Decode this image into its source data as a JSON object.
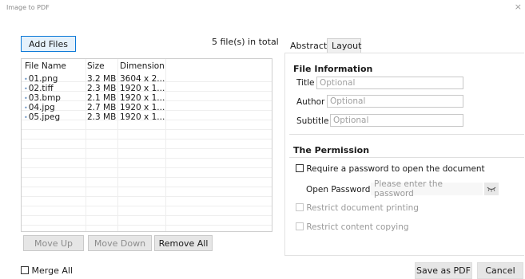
{
  "window": {
    "title": "Image to PDF",
    "close": "×"
  },
  "left": {
    "add_files": "Add Files",
    "file_count": "5 file(s) in total",
    "columns": [
      "File Name",
      "Size",
      "Dimension"
    ],
    "files": [
      {
        "name": "01.png",
        "size": "3.2 MB",
        "dimension": "3604 x 2..."
      },
      {
        "name": "02.tiff",
        "size": "2.3 MB",
        "dimension": "1920 x 1..."
      },
      {
        "name": "03.bmp",
        "size": "2.1 MB",
        "dimension": "1920 x 1..."
      },
      {
        "name": "04.jpg",
        "size": "2.7 MB",
        "dimension": "1920 x 1..."
      },
      {
        "name": "05.jpeg",
        "size": "2.3 MB",
        "dimension": "1920 x 1..."
      }
    ],
    "move_up": "Move Up",
    "move_down": "Move Down",
    "remove_all": "Remove All",
    "merge_all": "Merge All"
  },
  "tabs": [
    {
      "label": "Abstract",
      "active": true
    },
    {
      "label": "Layout",
      "active": false
    }
  ],
  "file_info": {
    "heading": "File Information",
    "title_label": "Title",
    "title_placeholder": "Optional",
    "author_label": "Author",
    "author_placeholder": "Optional",
    "subtitle_label": "Subtitle",
    "subtitle_placeholder": "Optional"
  },
  "permission": {
    "heading": "The Permission",
    "require_password": "Require a password to open the document",
    "open_password_label": "Open Password",
    "open_password_placeholder": "Please enter the password",
    "restrict_printing": "Restrict document printing",
    "restrict_copying": "Restrict content copying"
  },
  "footer": {
    "save": "Save as PDF",
    "cancel": "Cancel"
  },
  "colors": {
    "accent_border": "#0a78d7",
    "accent_fill": "#e5f1fb",
    "file_dot": "#6f98c7"
  }
}
